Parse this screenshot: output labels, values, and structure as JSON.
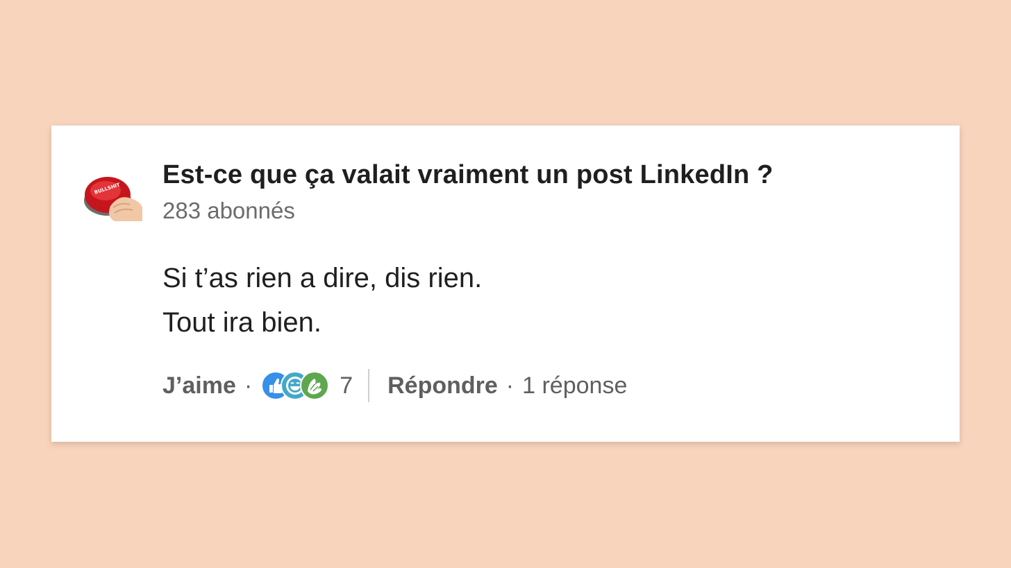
{
  "post": {
    "author_name": "Est-ce que ça valait vraiment un post LinkedIn ?",
    "followers": "283 abonnés",
    "avatar_icon": "red-button-avatar",
    "avatar_label": "BULLSHIT",
    "comment_lines": [
      "Si t’as rien a dire, dis rien.",
      "Tout ira bien."
    ]
  },
  "actions": {
    "like_label": "J’aime",
    "separator": "·",
    "reactions": [
      {
        "icon": "like-reaction-icon",
        "color": "#378fe9"
      },
      {
        "icon": "funny-reaction-icon",
        "color": "#44a8c7"
      },
      {
        "icon": "celebrate-reaction-icon",
        "color": "#5fa74f"
      }
    ],
    "reaction_count": "7",
    "reply_label": "Répondre",
    "replies": "1 réponse"
  }
}
